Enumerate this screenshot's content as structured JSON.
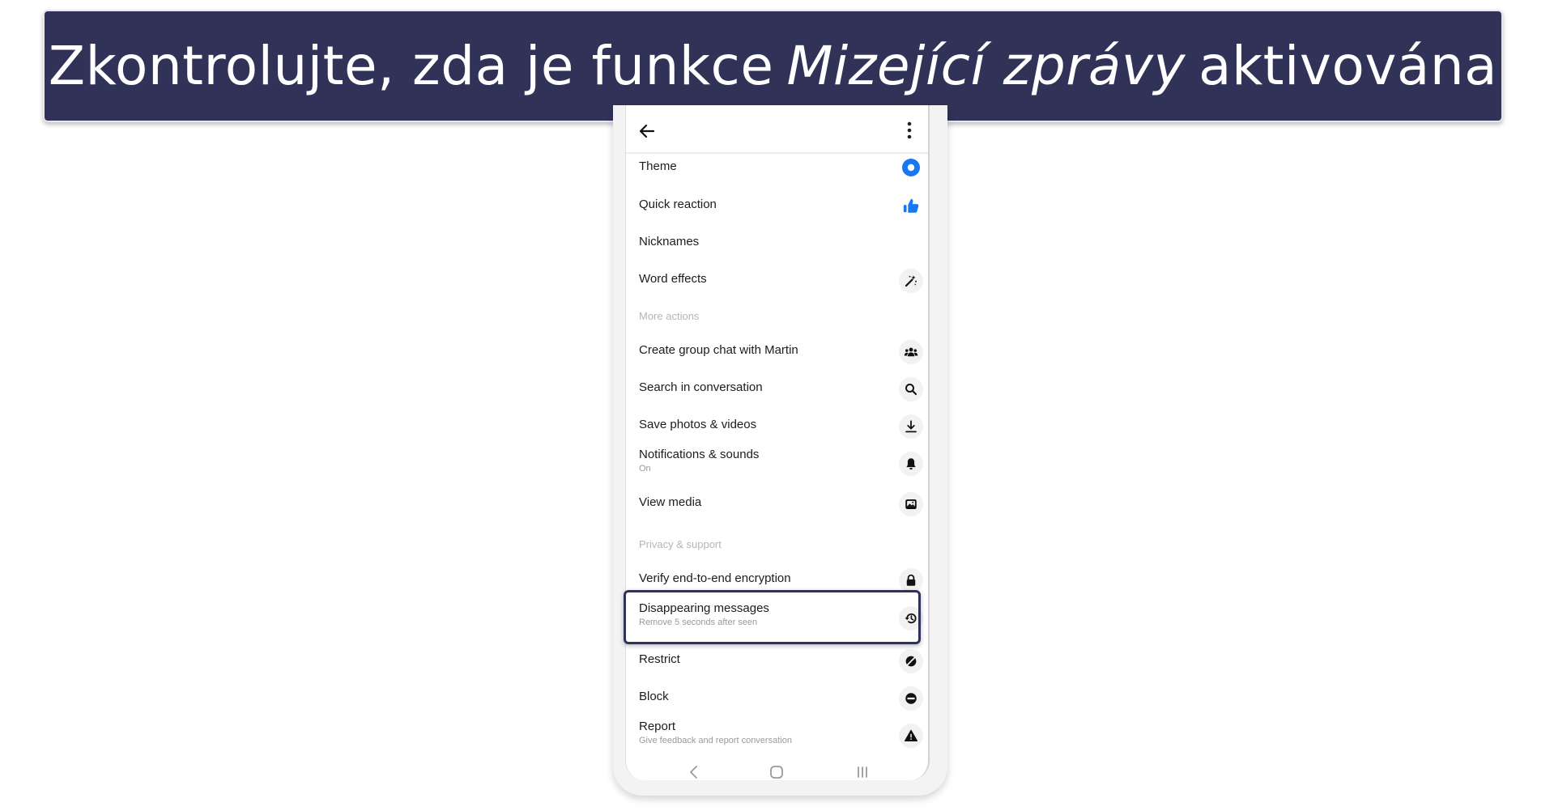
{
  "banner": {
    "text_before": "Zkontrolujte, zda je funkce",
    "text_emphasis": "Mizející zprávy",
    "text_after": "aktivována",
    "background_color": "#303257"
  },
  "phone": {
    "header": {
      "back_icon": "arrow-left-icon",
      "menu_icon": "more-vertical-icon"
    },
    "items": [
      {
        "id": "theme",
        "label": "Theme",
        "icon": "theme-circle-icon",
        "icon_color": "#1877f2"
      },
      {
        "id": "quick-reaction",
        "label": "Quick reaction",
        "icon": "thumbs-up-icon",
        "icon_color": "#1877f2"
      },
      {
        "id": "nicknames",
        "label": "Nicknames"
      },
      {
        "id": "word-effects",
        "label": "Word effects",
        "icon": "magic-wand-icon"
      }
    ],
    "more_actions": {
      "header": "More actions",
      "items": [
        {
          "id": "create-group",
          "label": "Create group chat with Martin",
          "icon": "group-icon"
        },
        {
          "id": "search",
          "label": "Search in conversation",
          "icon": "search-icon"
        },
        {
          "id": "save-media",
          "label": "Save photos & videos",
          "icon": "download-icon"
        },
        {
          "id": "notifications",
          "label": "Notifications & sounds",
          "sublabel": "On",
          "icon": "bell-icon"
        },
        {
          "id": "view-media",
          "label": "View media",
          "icon": "image-icon"
        }
      ]
    },
    "privacy_support": {
      "header": "Privacy & support",
      "items": [
        {
          "id": "verify-encryption",
          "label": "Verify end-to-end encryption",
          "icon": "lock-icon"
        },
        {
          "id": "disappearing",
          "label": "Disappearing messages",
          "sublabel": "Remove 5 seconds after seen",
          "icon": "history-icon",
          "highlighted": true
        },
        {
          "id": "restrict",
          "label": "Restrict",
          "icon": "restrict-icon"
        },
        {
          "id": "block",
          "label": "Block",
          "icon": "block-icon"
        },
        {
          "id": "report",
          "label": "Report",
          "sublabel": "Give feedback and report conversation",
          "icon": "warning-icon"
        }
      ]
    },
    "navbar": {
      "back": "nav-back-icon",
      "home": "nav-home-icon",
      "recents": "nav-recents-icon"
    },
    "highlight_color": "#2f3258"
  }
}
